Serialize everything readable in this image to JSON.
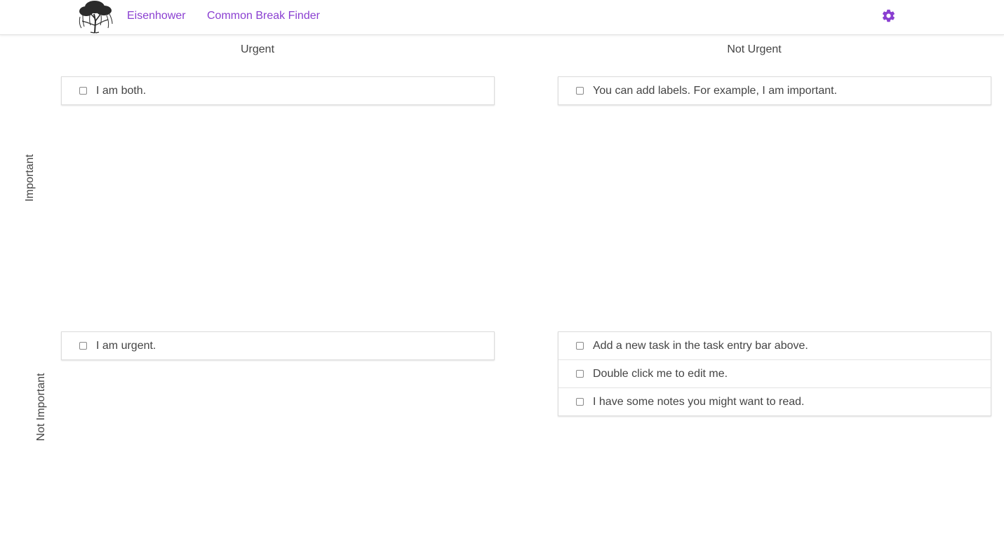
{
  "nav": {
    "links": [
      "Eisenhower",
      "Common Break Finder"
    ],
    "settings_icon": "gear-icon",
    "accent": "#8a3fd1"
  },
  "matrix": {
    "columns": [
      "Urgent",
      "Not Urgent"
    ],
    "rows": [
      "Important",
      "Not Important"
    ],
    "quadrants": {
      "urgent_important": [
        "I am both."
      ],
      "not_urgent_important": [
        "You can add labels. For example, I am important."
      ],
      "urgent_not_important": [
        "I am urgent."
      ],
      "not_urgent_not_important": [
        "Add a new task in the task entry bar above.",
        "Double click me to edit me.",
        "I have some notes you might want to read."
      ]
    }
  }
}
